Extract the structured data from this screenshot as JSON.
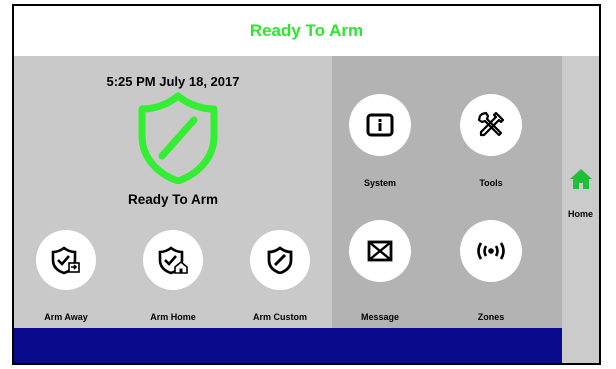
{
  "header": {
    "title": "Ready To Arm",
    "title_color": "#2ee62e"
  },
  "status": {
    "datetime": "5:25 PM July 18, 2017",
    "label": "Ready To Arm",
    "shield_icon": "shield-slash-icon",
    "shield_color": "#33ee33"
  },
  "arm_buttons": [
    {
      "label": "Arm Away",
      "icon": "shield-check-away-icon"
    },
    {
      "label": "Arm Home",
      "icon": "shield-check-home-icon"
    },
    {
      "label": "Arm Custom",
      "icon": "shield-slash-icon"
    }
  ],
  "menu_buttons": [
    {
      "label": "System",
      "icon": "info-icon"
    },
    {
      "label": "Tools",
      "icon": "tools-icon"
    },
    {
      "label": "Message",
      "icon": "envelope-icon"
    },
    {
      "label": "Zones",
      "icon": "wireless-signal-icon"
    }
  ],
  "sidebar": {
    "home_label": "Home",
    "home_icon": "home-icon",
    "home_color": "#1fbf3a"
  },
  "colors": {
    "left_panel": "#c9c9c9",
    "mid_panel": "#b3b3b3",
    "bottom_bar": "#0a0a8c"
  }
}
